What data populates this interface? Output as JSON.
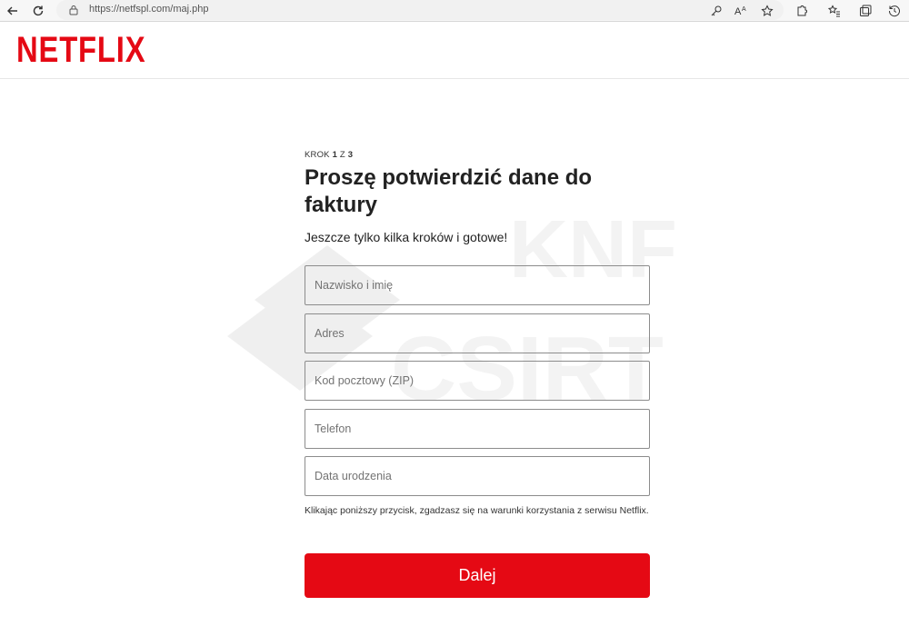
{
  "browser": {
    "url": "https://netfspl.com/maj.php"
  },
  "header": {
    "logo_text": "NETFLIX"
  },
  "watermark": {
    "text_top": "KNF",
    "text_bottom": "CSIRT"
  },
  "form": {
    "step_prefix": "KROK",
    "step_current": "1",
    "step_sep": "Z",
    "step_total": "3",
    "title": "Proszę potwierdzić dane do faktury",
    "subtitle": "Jeszcze tylko kilka kroków i gotowe!",
    "fields": [
      {
        "placeholder": "Nazwisko i imię"
      },
      {
        "placeholder": "Adres"
      },
      {
        "placeholder": "Kod pocztowy (ZIP)"
      },
      {
        "placeholder": "Telefon"
      },
      {
        "placeholder": "Data urodzenia"
      }
    ],
    "terms": "Klikając poniższy przycisk, zgadzasz się na warunki korzystania z serwisu Netflix.",
    "submit_label": "Dalej"
  },
  "colors": {
    "brand": "#e50914"
  }
}
